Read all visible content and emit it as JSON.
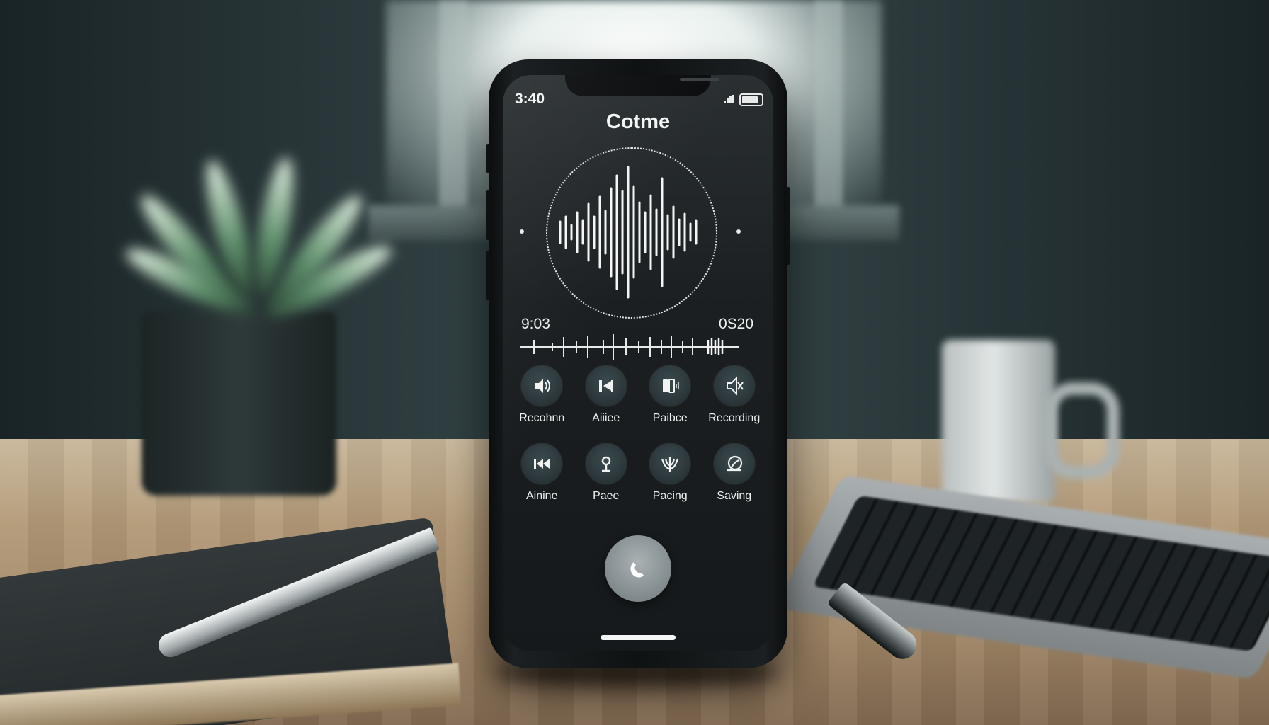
{
  "status_bar": {
    "time": "3:40",
    "icons": [
      "signal-icon",
      "battery-icon"
    ]
  },
  "app": {
    "title": "Cotme"
  },
  "player": {
    "elapsed": "9:03",
    "total": "0S20"
  },
  "controls": [
    {
      "label": "Recohnn",
      "icon": "volume-icon"
    },
    {
      "label": "Aiiiee",
      "icon": "skip-back-icon"
    },
    {
      "label": "Paibce",
      "icon": "pause-icon"
    },
    {
      "label": "Recording",
      "icon": "mute-icon"
    },
    {
      "label": "Ainine",
      "icon": "rewind-icon"
    },
    {
      "label": "Paee",
      "icon": "microphone-icon"
    },
    {
      "label": "Pacing",
      "icon": "waves-icon"
    },
    {
      "label": "Saving",
      "icon": "loop-icon"
    }
  ],
  "call_button": {
    "icon": "phone-icon"
  },
  "colors": {
    "screen_bg": "#1b1f21",
    "text": "#eef0f0",
    "button_bg": "#2c383c",
    "call_button": "#8a9497"
  }
}
